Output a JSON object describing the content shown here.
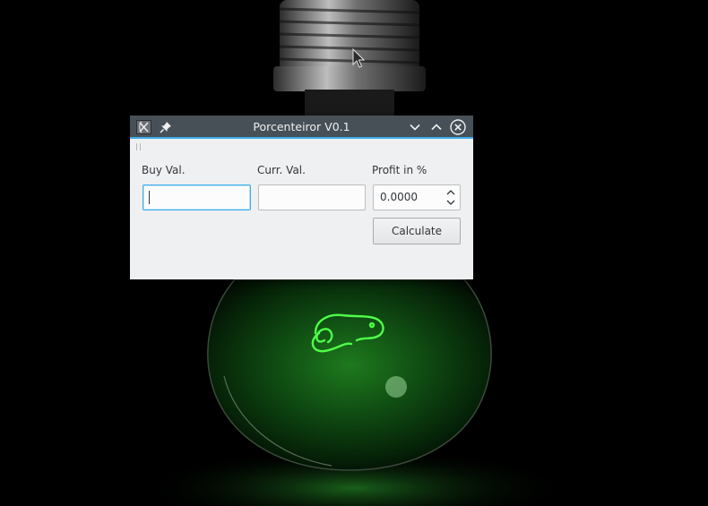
{
  "window": {
    "title": "Porcenteiror V0.1"
  },
  "form": {
    "buy_label": "Buy Val.",
    "buy_value": "",
    "curr_label": "Curr. Val.",
    "curr_value": "",
    "profit_label": "Profit in %",
    "profit_value": "0.0000",
    "calculate_label": "Calculate"
  },
  "icons": {
    "app": "app-icon",
    "pin": "pin-icon",
    "minimize": "chevron-down-icon",
    "maximize": "chevron-up-icon",
    "close": "close-icon",
    "spin_up": "chevron-up-icon",
    "spin_down": "chevron-down-icon"
  },
  "colors": {
    "titlebar": "#475057",
    "accent": "#3daee9",
    "window_bg": "#eff0f1",
    "bulb_glow": "#3bdc3b"
  }
}
